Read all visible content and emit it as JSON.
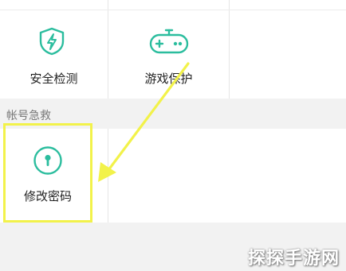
{
  "tiles_top": [
    {
      "label": "安全检测",
      "icon": "shield-lightning-icon"
    },
    {
      "label": "游戏保护",
      "icon": "gamepad-icon"
    }
  ],
  "section": {
    "title": "帐号急救"
  },
  "tiles_bottom": [
    {
      "label": "修改密码",
      "icon": "keyhole-icon"
    }
  ],
  "annotation": {
    "highlight_color": "#f2f24a"
  },
  "watermark": "探探手游网",
  "colors": {
    "accent": "#2bbd9e"
  }
}
